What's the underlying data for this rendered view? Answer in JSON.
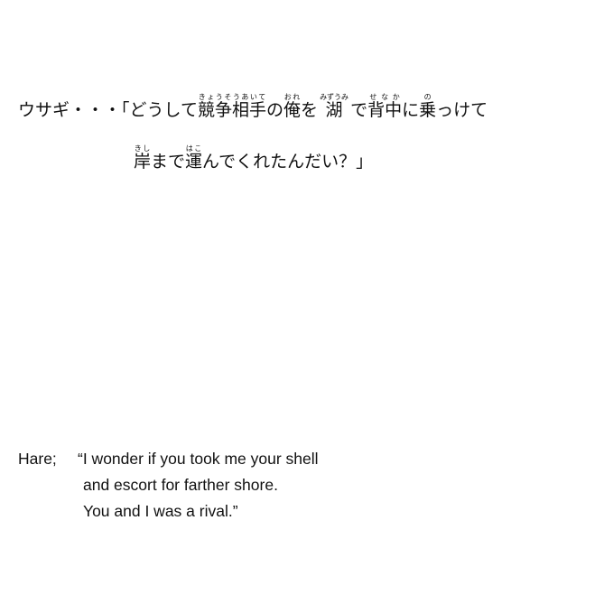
{
  "japanese": {
    "line1": {
      "speaker": "ウサギ・・・",
      "open_quote": "「",
      "t1": "どうして",
      "kyousouaite_base": "競争相手",
      "kyousouaite_ruby": "きょうそうあいて",
      "t2": "の",
      "ore_base": "俺",
      "ore_ruby": "おれ",
      "t3": "を ",
      "mizuumi_base": "湖",
      "mizuumi_ruby": "みずうみ",
      "t4": " で",
      "senaka_base": "背中",
      "senaka_ruby": "せなか",
      "t5": "に",
      "no_base": "乗",
      "no_ruby": "の",
      "t6": "っけて"
    },
    "line2": {
      "kishi_base": "岸",
      "kishi_ruby": "きし",
      "t1": "まで",
      "hako_base": "運",
      "hako_ruby": "はこ",
      "t2": "んでくれたんだい？」"
    }
  },
  "english": {
    "speaker": "Hare;",
    "line1": "“I wonder if you took me your shell",
    "line2": "and escort for farther shore.",
    "line3": "You and I was a rival.”"
  }
}
